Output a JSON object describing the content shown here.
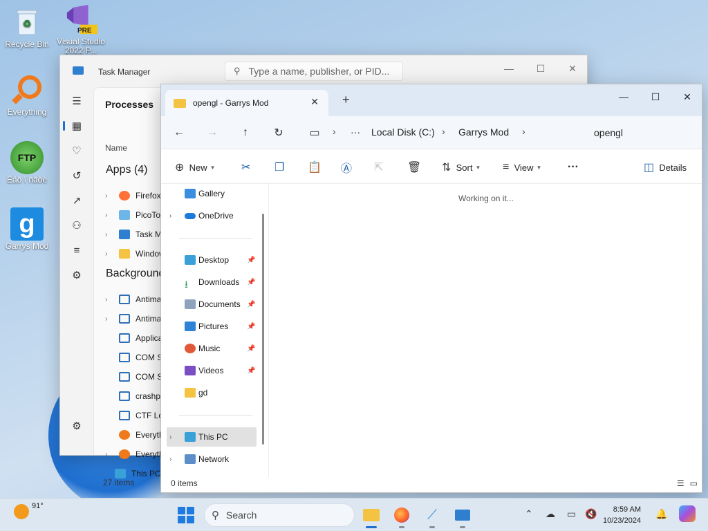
{
  "desktop": {
    "icons": [
      {
        "label": "Recycle Bin"
      },
      {
        "label": "Visual Studio 2022 P...",
        "badge": "PRE"
      },
      {
        "label": "Everything"
      },
      {
        "label": "Ëäõ ï ñãõè",
        "badge": "FTP"
      },
      {
        "label": "Garrys Mod",
        "glyph": "g"
      }
    ]
  },
  "task_manager": {
    "title": "Task Manager",
    "search_placeholder": "Type a name, publisher, or PID...",
    "heading": "Processes",
    "column_name": "Name",
    "apps_group": "Apps (4)",
    "apps": [
      "Firefox",
      "PicoTor",
      "Task M",
      "Window"
    ],
    "background_group": "Background",
    "background": [
      "Antima",
      "Antima",
      "Applica",
      "COM S",
      "COM S",
      "crashpa",
      "CTF Lo",
      "Everyth",
      "Everyth"
    ],
    "footer": "27 items",
    "this_pc": "This PC"
  },
  "explorer": {
    "tab_title": "opengl - Garrys Mod",
    "breadcrumb": [
      "Local Disk (C:)",
      "Garrys Mod"
    ],
    "ellipsis": "···",
    "search_value": "opengl",
    "toolbar": {
      "new": "New",
      "sort": "Sort",
      "view": "View",
      "more": "···",
      "details": "Details"
    },
    "nav": {
      "gallery": "Gallery",
      "onedrive": "OneDrive",
      "desktop": "Desktop",
      "downloads": "Downloads",
      "documents": "Documents",
      "pictures": "Pictures",
      "music": "Music",
      "videos": "Videos",
      "gd": "gd",
      "this_pc": "This PC",
      "network": "Network"
    },
    "working_text": "Working on it...",
    "status": "0 items"
  },
  "taskbar": {
    "weather_temp": "91°",
    "search_placeholder": "Search",
    "time": "8:59 AM",
    "date": "10/23/2024"
  },
  "colors": {
    "accent": "#1f6fd0",
    "folder": "#f5c342",
    "taskbar": "#dde7f1"
  }
}
